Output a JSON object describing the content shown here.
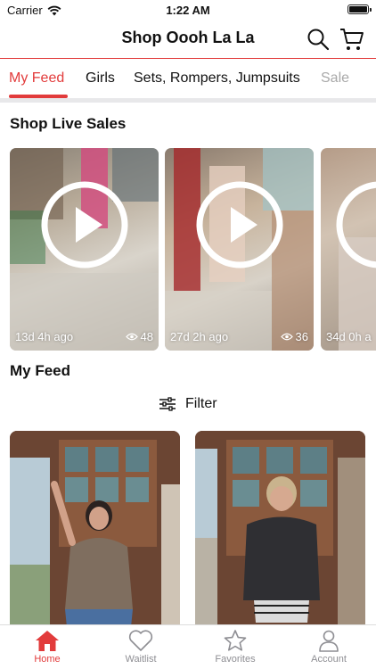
{
  "status": {
    "carrier": "Carrier",
    "time": "1:22 AM"
  },
  "header": {
    "title": "Shop Oooh La La"
  },
  "tabs": [
    {
      "label": "My Feed"
    },
    {
      "label": "Girls"
    },
    {
      "label": "Sets, Rompers, Jumpsuits"
    },
    {
      "label": "Sale"
    }
  ],
  "live_sales": {
    "title": "Shop Live Sales",
    "items": [
      {
        "age": "13d 4h ago",
        "views": "48"
      },
      {
        "age": "27d 2h ago",
        "views": "36"
      },
      {
        "age": "34d 0h a"
      }
    ]
  },
  "feed": {
    "title": "My Feed",
    "filter_label": "Filter"
  },
  "tabbar": [
    {
      "label": "Home",
      "icon": "home-icon"
    },
    {
      "label": "Waitlist",
      "icon": "heart-icon"
    },
    {
      "label": "Favorites",
      "icon": "star-icon"
    },
    {
      "label": "Account",
      "icon": "person-icon"
    }
  ],
  "colors": {
    "accent": "#e23b3b"
  }
}
